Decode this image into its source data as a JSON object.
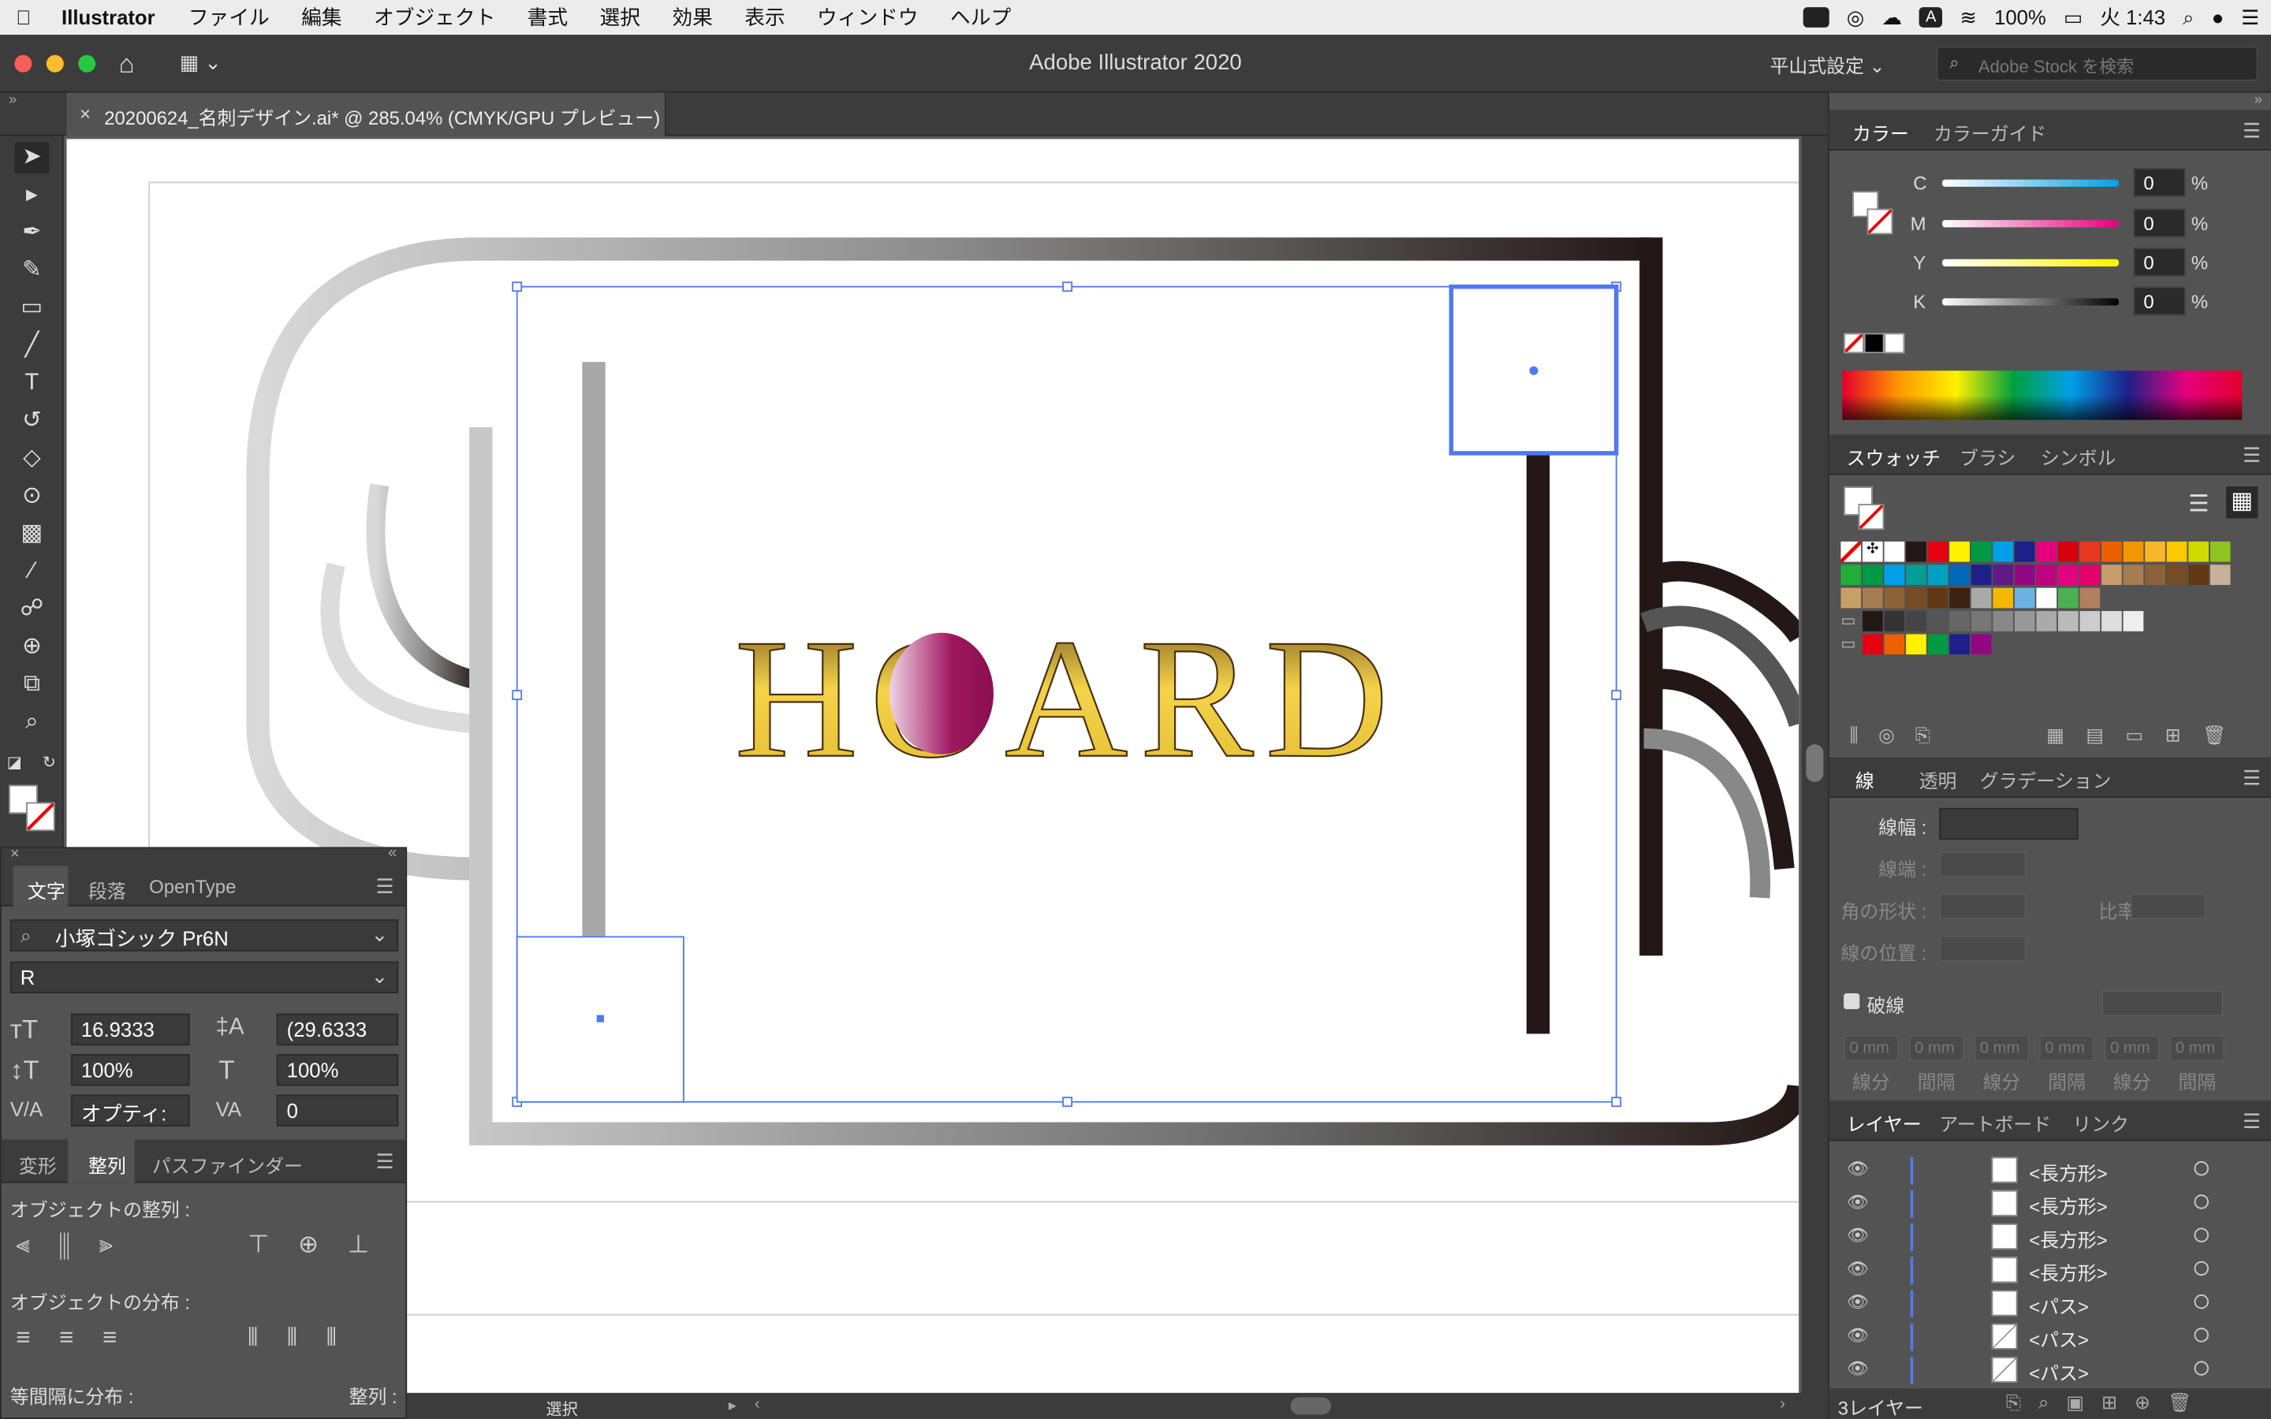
{
  "menubar": {
    "app": "Illustrator",
    "items": [
      "ファイル",
      "編集",
      "オブジェクト",
      "書式",
      "選択",
      "効果",
      "表示",
      "ウィンドウ",
      "ヘルプ"
    ],
    "battery": "100%",
    "clock": "火 1:43"
  },
  "window": {
    "title": "Adobe Illustrator 2020",
    "workspace": "平山式設定",
    "stock_placeholder": "Adobe Stock を検索"
  },
  "doc_tab": {
    "label": "20200624_名刺デザイン.ai* @ 285.04% (CMYK/GPU プレビュー)"
  },
  "artwork": {
    "logo_text": "HOARD",
    "accent_colors": {
      "gold": "#d8b23a",
      "magenta": "#a0165f",
      "frame_dark": "#231815"
    }
  },
  "color_panel": {
    "tabs": [
      "カラー",
      "カラーガイド"
    ],
    "channels": [
      {
        "name": "C",
        "value": "0",
        "unit": "%"
      },
      {
        "name": "M",
        "value": "0",
        "unit": "%"
      },
      {
        "name": "Y",
        "value": "0",
        "unit": "%"
      },
      {
        "name": "K",
        "value": "0",
        "unit": "%"
      }
    ]
  },
  "swatch_panel": {
    "tabs": [
      "スウォッチ",
      "ブラシ",
      "シンボル"
    ]
  },
  "stroke_panel": {
    "tabs": [
      "線",
      "透明",
      "グラデーション"
    ],
    "weight_label": "線幅 :",
    "cap_label": "線端 :",
    "corner_label": "角の形状 :",
    "ratio_label": "比率 :",
    "align_label": "線の位置 :",
    "dashed_label": "破線",
    "dash_labels": [
      "線分",
      "間隔",
      "線分",
      "間隔",
      "線分",
      "間隔"
    ],
    "dash_placeholder": "0 mm"
  },
  "layers_panel": {
    "tabs": [
      "レイヤー",
      "アートボード",
      "リンク"
    ],
    "rows": [
      "<長方形>",
      "<長方形>",
      "<長方形>",
      "<長方形>",
      "<パス>",
      "<パス>",
      "<パス>"
    ],
    "footer": "3レイヤー"
  },
  "char_panel": {
    "tabs": [
      "文字",
      "段落",
      "OpenType"
    ],
    "font_family": "小塚ゴシック Pr6N",
    "font_style": "R",
    "font_size": "16.9333",
    "leading": "(29.6333",
    "vscale": "100%",
    "hscale": "100%",
    "kerning": "オプティ:",
    "tracking": "0"
  },
  "align_panel": {
    "tabs": [
      "変形",
      "整列",
      "パスファインダー"
    ],
    "align_objects": "オブジェクトの整列 :",
    "distribute_objects": "オブジェクトの分布 :",
    "distribute_spacing": "等間隔に分布 :",
    "align_to": "整列 :"
  },
  "status": {
    "tool": "選択"
  }
}
